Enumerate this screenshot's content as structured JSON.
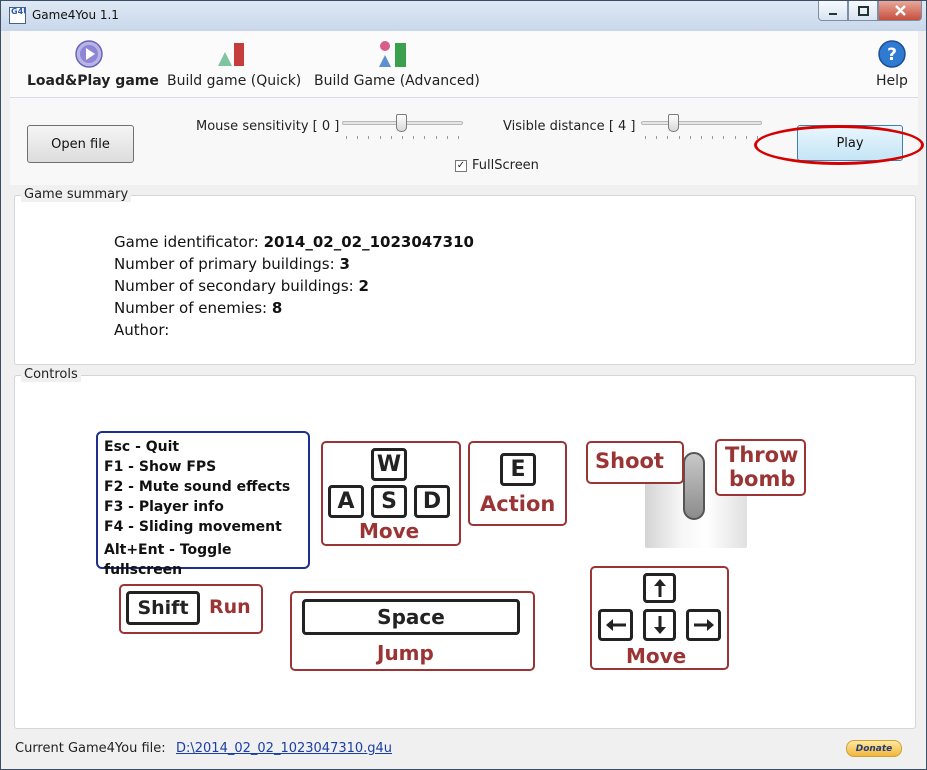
{
  "window": {
    "title": "Game4You 1.1",
    "icon_text": "G4U"
  },
  "toolbar": {
    "load_play": "Load&Play game",
    "build_quick": "Build game (Quick)",
    "build_advanced": "Build Game (Advanced)",
    "help": "Help"
  },
  "options": {
    "open_file": "Open file",
    "mouse_sensitivity_label": "Mouse sensitivity [ 0 ]",
    "mouse_sensitivity_value": 0,
    "visible_distance_label": "Visible distance [ 4 ]",
    "visible_distance_value": 4,
    "fullscreen_label": "FullScreen",
    "fullscreen_checked": true,
    "play": "Play"
  },
  "summary": {
    "title": "Game summary",
    "game_id_label": "Game identificator:",
    "game_id_value": "2014_02_02_1023047310",
    "primary_label": "Number of primary buildings:",
    "primary_value": "3",
    "secondary_label": "Number of secondary buildings:",
    "secondary_value": "2",
    "enemies_label": "Number of enemies:",
    "enemies_value": "8",
    "author_label": "Author:"
  },
  "controls": {
    "title": "Controls",
    "shortcuts": [
      "Esc - Quit",
      "F1 - Show FPS",
      "F2 - Mute sound effects",
      "F3 - Player info",
      "F4 - Sliding movement",
      "Alt+Ent - Toggle fullscreen"
    ],
    "wasd": {
      "w": "W",
      "a": "A",
      "s": "S",
      "d": "D",
      "label": "Move"
    },
    "e": {
      "key": "E",
      "label": "Action"
    },
    "mouse": {
      "shoot": "Shoot",
      "throw1": "Throw",
      "throw2": "bomb"
    },
    "shift": {
      "key": "Shift",
      "label": "Run"
    },
    "space": {
      "key": "Space",
      "label": "Jump"
    },
    "arrows": {
      "label": "Move"
    }
  },
  "status": {
    "label": "Current Game4You file:",
    "file": "D:\\2014_02_02_1023047310.g4u",
    "donate": "Donate"
  }
}
